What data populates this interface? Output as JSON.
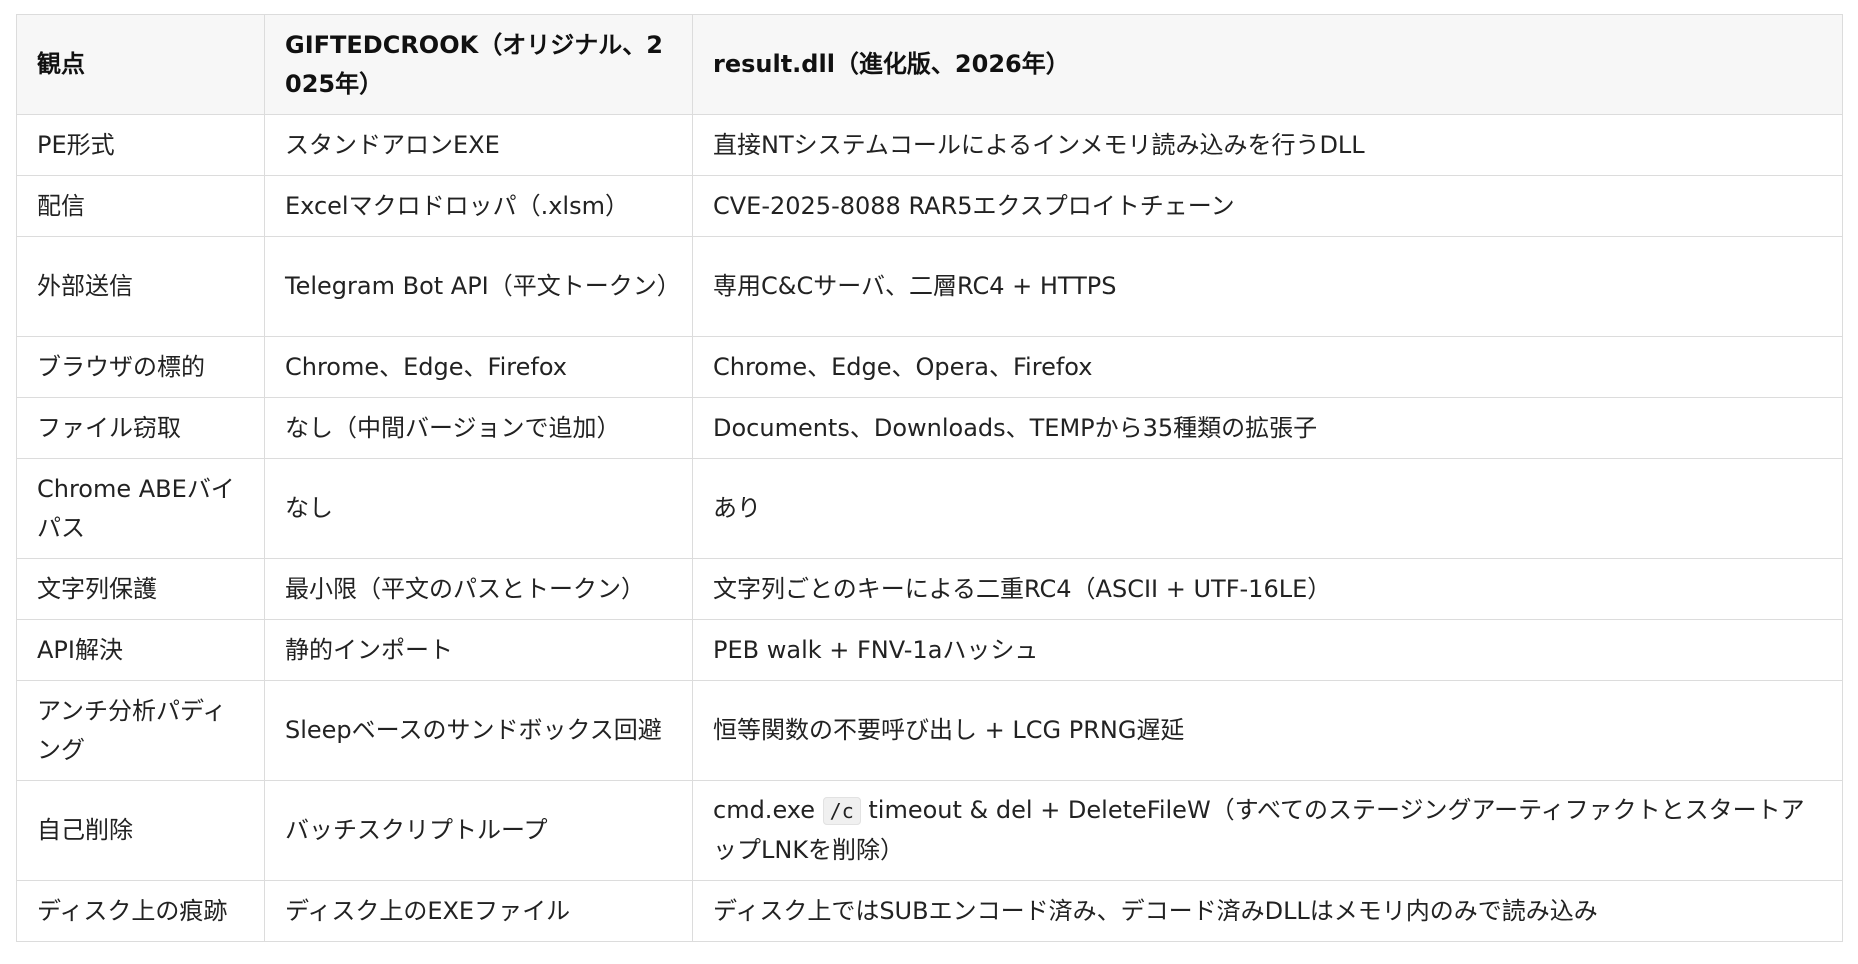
{
  "table": {
    "headers": [
      "観点",
      "GIFTEDCROOK（オリジナル、2025年）",
      "result.dll（進化版、2026年）"
    ],
    "rows": [
      {
        "aspect": "PE形式",
        "original": "スタンドアロンEXE",
        "evolved": "直接NTシステムコールによるインメモリ読み込みを行うDLL"
      },
      {
        "aspect": "配信",
        "original": "Excelマクロドロッパ（.xlsm）",
        "evolved": "CVE-2025-8088 RAR5エクスプロイトチェーン"
      },
      {
        "aspect": "外部送信",
        "original": "Telegram Bot API（平文トークン）",
        "evolved": "専用C&Cサーバ、二層RC4 + HTTPS"
      },
      {
        "aspect": "ブラウザの標的",
        "original": "Chrome、Edge、Firefox",
        "evolved": "Chrome、Edge、Opera、Firefox"
      },
      {
        "aspect": "ファイル窃取",
        "original": "なし（中間バージョンで追加）",
        "evolved": "Documents、Downloads、TEMPから35種類の拡張子"
      },
      {
        "aspect": "Chrome ABEバイパス",
        "original": "なし",
        "evolved": "あり"
      },
      {
        "aspect": "文字列保護",
        "original": "最小限（平文のパスとトークン）",
        "evolved": "文字列ごとのキーによる二重RC4（ASCII + UTF-16LE）"
      },
      {
        "aspect": "API解決",
        "original": "静的インポート",
        "evolved": "PEB walk + FNV-1aハッシュ"
      },
      {
        "aspect": "アンチ分析パディング",
        "original": "Sleepベースのサンドボックス回避",
        "evolved": "恒等関数の不要呼び出し + LCG PRNG遅延"
      },
      {
        "aspect": "自己削除",
        "original": "バッチスクリプトループ",
        "evolved_before": "cmd.exe",
        "evolved_code": "/c",
        "evolved_after": "timeout & del + DeleteFileW（すべてのステージングアーティファクトとスタートアップLNKを削除）"
      },
      {
        "aspect": "ディスク上の痕跡",
        "original": "ディスク上のEXEファイル",
        "evolved": "ディスク上ではSUBエンコード済み、デコード済みDLLはメモリ内のみで読み込み"
      }
    ]
  }
}
